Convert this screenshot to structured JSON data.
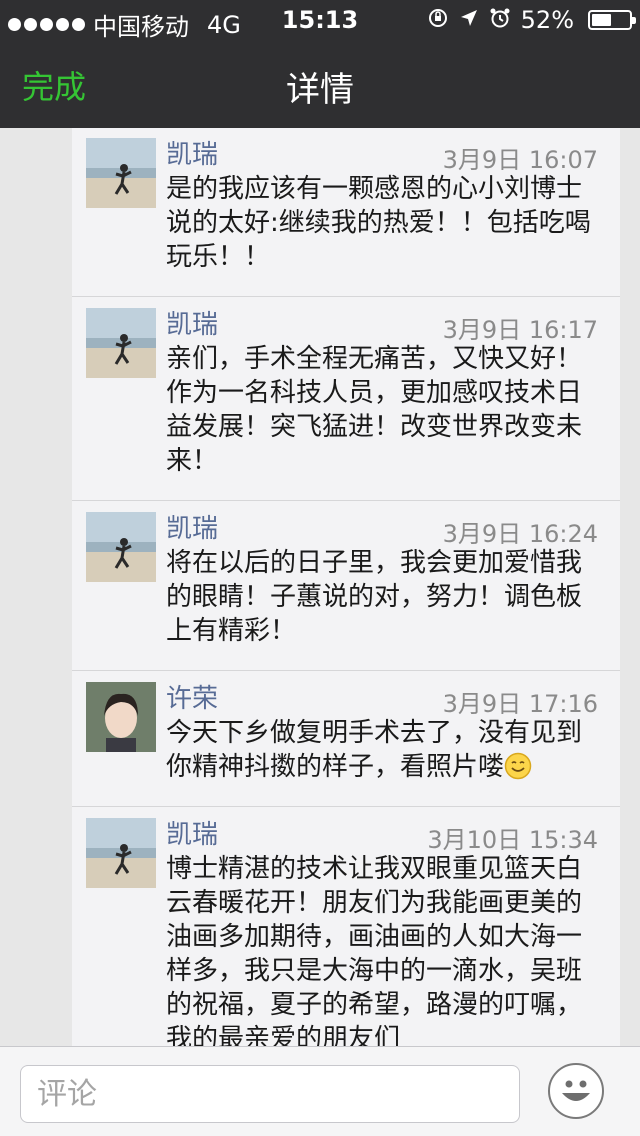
{
  "status_bar": {
    "carrier": "中国移动",
    "network": "4G",
    "time": "15:13",
    "battery_text": "52%",
    "battery_level": 0.52
  },
  "nav": {
    "done_label": "完成",
    "title": "详情"
  },
  "comments": [
    {
      "name": "凯瑞",
      "time": "3月9日 16:07",
      "text": "是的我应该有一颗感恩的心小刘博士说的太好:继续我的热爱！！包括吃喝玩乐！！"
    },
    {
      "name": "凯瑞",
      "time": "3月9日 16:17",
      "text": "亲们，手术全程无痛苦，又快又好！作为一名科技人员，更加感叹技术日益发展！突飞猛进！改变世界改变未来！"
    },
    {
      "name": "凯瑞",
      "time": "3月9日 16:24",
      "text": "将在以后的日子里，我会更加爱惜我的眼睛！子蕙说的对，努力！调色板上有精彩！"
    },
    {
      "name": "许荣",
      "time": "3月9日 17:16",
      "text": "今天下乡做复明手术去了，没有见到你精神抖擞的样子，看照片喽"
    },
    {
      "name": "凯瑞",
      "time": "3月10日 15:34",
      "text": "博士精湛的技术让我双眼重见篮天白云春暖花开！朋友们为我能画更美的油画多加期待，画油画的人如大海一样多，我只是大海中的一滴水，吴班的祝福，夏子的希望，路漫的叮嘱，我的最亲爱的朋友们"
    }
  ],
  "input": {
    "placeholder": "评论"
  },
  "colors": {
    "nav_bg": "#2f2f31",
    "done_green": "#35c534",
    "name_blue": "#576b95"
  }
}
